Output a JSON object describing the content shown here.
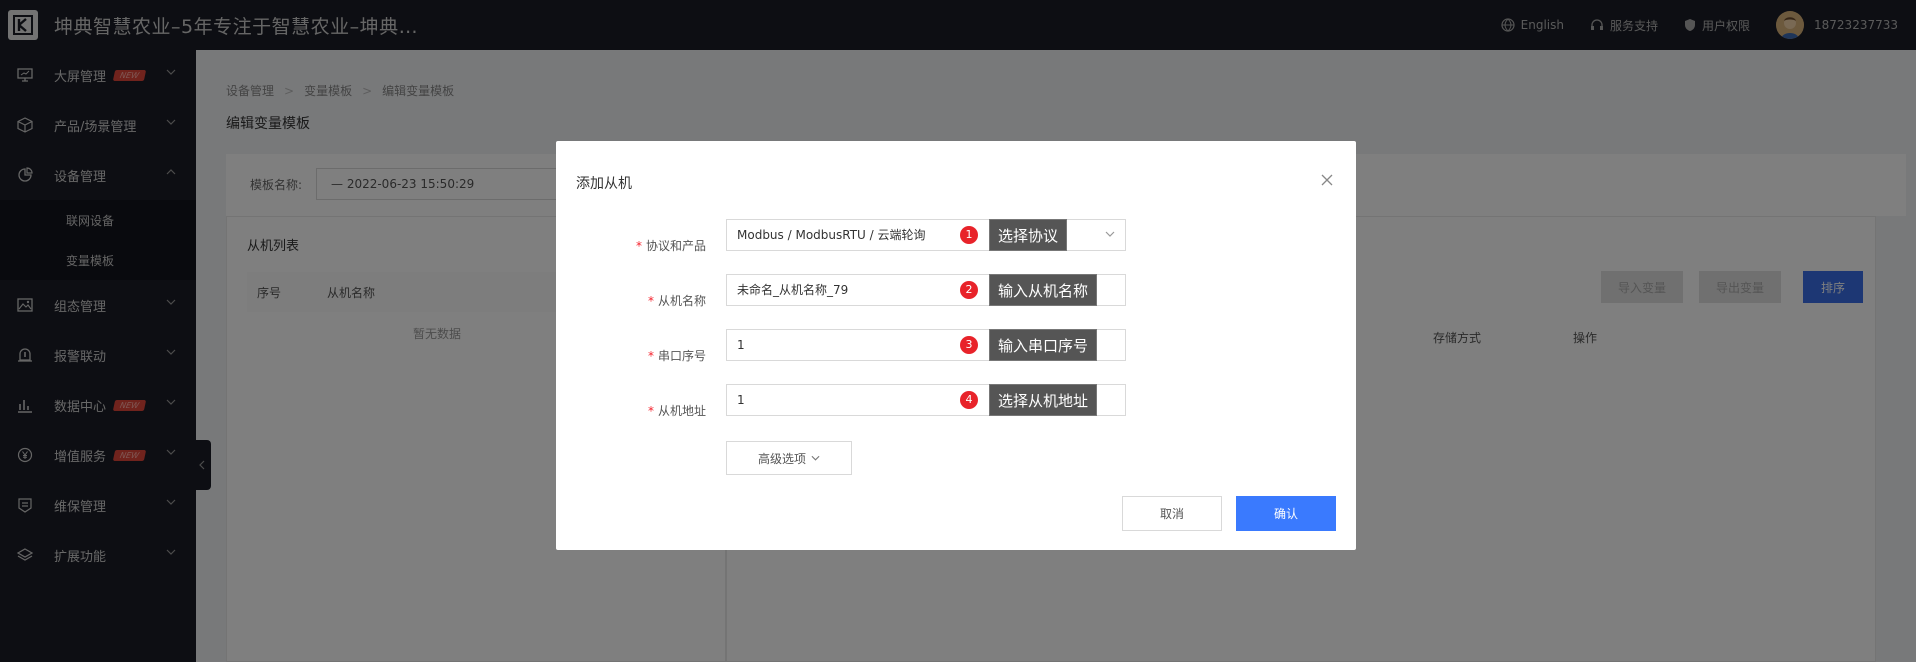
{
  "app": {
    "title": "坤典智慧农业–5年专注于智慧农业–坤典…"
  },
  "topbar": {
    "language": "English",
    "support": "服务支持",
    "permission": "用户权限",
    "phone": "18723237733"
  },
  "sidebar": {
    "items": [
      {
        "label": "大屏管理",
        "badge": "NEW"
      },
      {
        "label": "产品/场景管理"
      },
      {
        "label": "设备管理"
      },
      {
        "label": "组态管理"
      },
      {
        "label": "报警联动"
      },
      {
        "label": "数据中心",
        "badge": "NEW"
      },
      {
        "label": "增值服务",
        "badge": "NEW"
      },
      {
        "label": "维保管理"
      },
      {
        "label": "扩展功能"
      }
    ],
    "sub_items": [
      {
        "label": "联网设备"
      },
      {
        "label": "变量模板"
      }
    ]
  },
  "breadcrumb": [
    "设备管理",
    "变量模板",
    "编辑变量模板"
  ],
  "page": {
    "title": "编辑变量模板",
    "template_label": "模板名称:",
    "template_value": "— 2022-06-23 15:50:29",
    "slave_list_title": "从机列表",
    "slave_cols": [
      "序号",
      "从机名称"
    ],
    "empty_text": "暂无数据",
    "buttons": {
      "import": "导入变量",
      "export": "导出变量",
      "sort": "排序"
    },
    "var_cols": [
      "存储方式",
      "操作"
    ]
  },
  "modal": {
    "title": "添加从机",
    "fields": [
      {
        "label": "协议和产品",
        "value": "Modbus / ModbusRTU / 云端轮询",
        "callout_num": "1",
        "callout": "选择协议"
      },
      {
        "label": "从机名称",
        "value": "未命名_从机名称_79",
        "callout_num": "2",
        "callout": "输入从机名称"
      },
      {
        "label": "串口序号",
        "value": "1",
        "callout_num": "3",
        "callout": "输入串口序号"
      },
      {
        "label": "从机地址",
        "value": "1",
        "callout_num": "4",
        "callout": "选择从机地址"
      }
    ],
    "advanced": "高级选项",
    "cancel": "取消",
    "confirm": "确认"
  },
  "colors": {
    "primary": "#3a7afe",
    "sidebar_bg": "#1b1d26",
    "badge": "#e0463a",
    "callout_dot": "#e8232a"
  }
}
